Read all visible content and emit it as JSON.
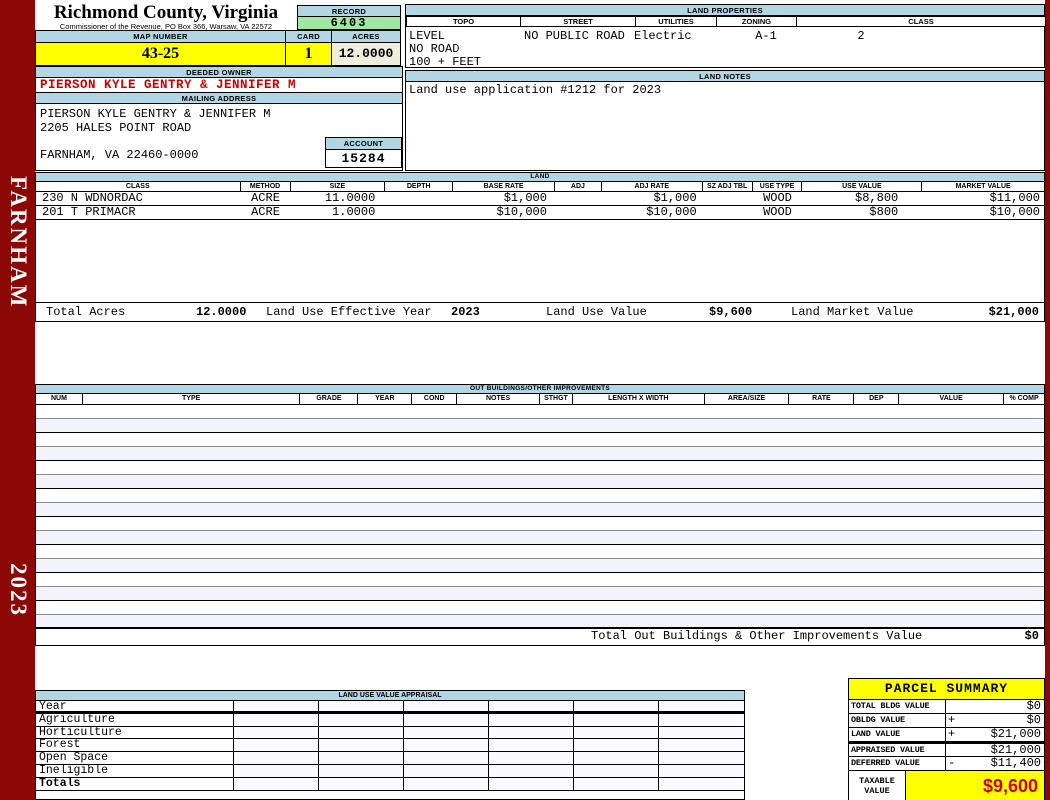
{
  "sidebar": {
    "district": "FARNHAM",
    "year": "2023"
  },
  "header": {
    "county": "Richmond County, Virginia",
    "commissioner": "Commissioner of the Revenue, PO Box 366, Warsaw, VA 22572",
    "record_label": "RECORD",
    "record_value": "6403",
    "map_label": "MAP NUMBER",
    "map_value": "43-25",
    "card_label": "CARD",
    "card_value": "1",
    "acres_label": "ACRES",
    "acres_value": "12.0000"
  },
  "owner": {
    "deeded_label": "DEEDED OWNER",
    "name": "PIERSON KYLE GENTRY & JENNIFER M",
    "mailing_label": "MAILING ADDRESS",
    "address_line1": "PIERSON KYLE GENTRY & JENNIFER M",
    "address_line2": "2205 HALES POINT ROAD",
    "address_line3": "FARNHAM, VA 22460-0000",
    "account_label": "ACCOUNT",
    "account_value": "15284"
  },
  "land_properties": {
    "title": "LAND PROPERTIES",
    "headers": [
      "TOPO",
      "STREET",
      "UTILITIES",
      "ZONING",
      "CLASS"
    ],
    "topo_line1": "LEVEL",
    "topo_line2": "NO ROAD",
    "topo_line3": "100 + FEET",
    "street": "NO PUBLIC ROAD",
    "utilities": "Electric",
    "zoning": "A-1",
    "class": "2"
  },
  "land_notes": {
    "title": "LAND NOTES",
    "note": "Land use application #1212 for 2023"
  },
  "land": {
    "title": "LAND",
    "headers": [
      "CLASS",
      "METHOD",
      "SIZE",
      "DEPTH",
      "BASE RATE",
      "ADJ",
      "ADJ RATE",
      "SZ ADJ TBL",
      "USE TYPE",
      "USE VALUE",
      "MARKET VALUE"
    ],
    "rows": [
      [
        "230 N WDNORDAC",
        "ACRE",
        "11.0000",
        "",
        "$1,000",
        "",
        "$1,000",
        "",
        "WOOD",
        "$8,800",
        "$11,000"
      ],
      [
        "201 T PRIMACR",
        "ACRE",
        "1.0000",
        "",
        "$10,000",
        "",
        "$10,000",
        "",
        "WOOD",
        "$800",
        "$10,000"
      ]
    ],
    "total_acres_label": "Total Acres",
    "total_acres": "12.0000",
    "effective_year_label": "Land Use Effective Year",
    "effective_year": "2023",
    "use_value_label": "Land Use Value",
    "use_value": "$9,600",
    "market_value_label": "Land Market Value",
    "market_value": "$21,000"
  },
  "out_buildings": {
    "title": "OUT BUILDINGS/OTHER IMPROVEMENTS",
    "headers": [
      "NUM",
      "TYPE",
      "GRADE",
      "YEAR",
      "COND",
      "NOTES",
      "STHGT",
      "LENGTH X WIDTH",
      "AREA/SIZE",
      "RATE",
      "DEP",
      "VALUE",
      "% COMP"
    ],
    "empty_row_count": 16,
    "total_label": "Total Out Buildings & Other Improvements Value",
    "total_value": "$0"
  },
  "land_use_appraisal": {
    "title": "LAND USE VALUE APPRAISAL",
    "row_labels": [
      "Year",
      "Agriculture",
      "Horticulture",
      "Forest",
      "Open Space",
      "Ineligible",
      "Totals"
    ],
    "column_count": 6
  },
  "parcel_summary": {
    "title": "PARCEL SUMMARY",
    "rows": [
      {
        "label": "TOTAL BLDG VALUE",
        "op": "",
        "value": "$0"
      },
      {
        "label": "OBLDG VALUE",
        "op": "+",
        "value": "$0"
      },
      {
        "label": "LAND VALUE",
        "op": "+",
        "value": "$21,000"
      },
      {
        "label": "APPRAISED VALUE",
        "op": "",
        "value": "$21,000"
      },
      {
        "label": "DEFERRED VALUE",
        "op": "-",
        "value": "$11,400"
      }
    ],
    "taxable_label_line1": "TAXABLE",
    "taxable_label_line2": "VALUE",
    "taxable_value": "$9,600"
  },
  "colors": {
    "maroon": "#8B0806",
    "header_blue": "#B2D6E4",
    "record_green": "#9FE8A4",
    "yellow": "#FFFF00",
    "cream": "#EEEEDF",
    "owner_red": "#CC0000",
    "taxable_red": "#CC0000"
  }
}
